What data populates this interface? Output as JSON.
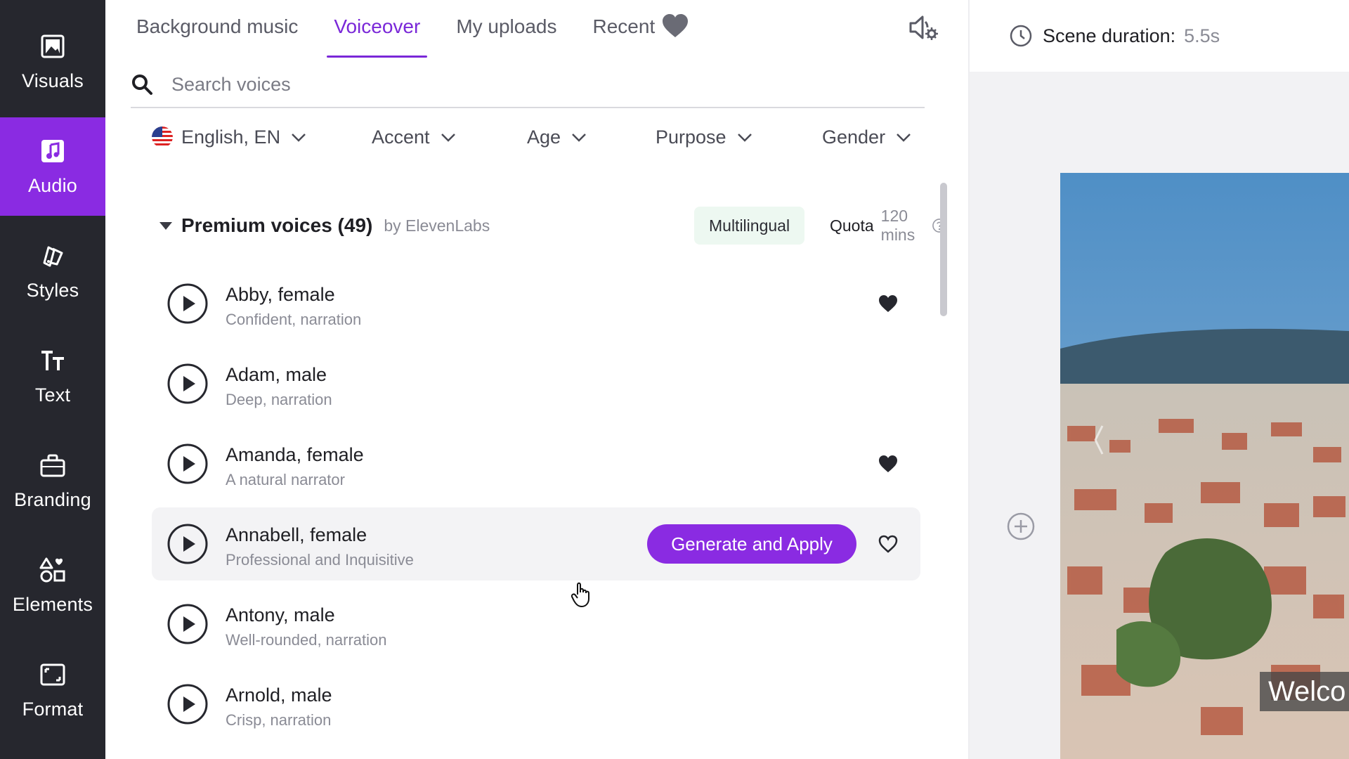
{
  "sidebar": {
    "items": [
      {
        "label": "Visuals",
        "icon": "image-icon",
        "active": false
      },
      {
        "label": "Audio",
        "icon": "music-note-icon",
        "active": true
      },
      {
        "label": "Styles",
        "icon": "styles-icon",
        "active": false
      },
      {
        "label": "Text",
        "icon": "text-icon",
        "active": false
      },
      {
        "label": "Branding",
        "icon": "briefcase-icon",
        "active": false
      },
      {
        "label": "Elements",
        "icon": "shapes-icon",
        "active": false
      },
      {
        "label": "Format",
        "icon": "format-icon",
        "active": false
      }
    ]
  },
  "tabs": [
    {
      "label": "Background music",
      "active": false
    },
    {
      "label": "Voiceover",
      "active": true
    },
    {
      "label": "My uploads",
      "active": false
    },
    {
      "label": "Recent",
      "active": false
    }
  ],
  "search": {
    "placeholder": "Search voices",
    "value": ""
  },
  "filters": {
    "language": "English, EN",
    "accent": "Accent",
    "age": "Age",
    "purpose": "Purpose",
    "gender": "Gender"
  },
  "section": {
    "title": "Premium voices (49)",
    "by": "by ElevenLabs",
    "badge": "Multilingual",
    "quota_label": "Quota",
    "quota_value": "120 mins"
  },
  "voices": [
    {
      "name": "Abby, female",
      "desc": "Confident, narration",
      "favorite": true
    },
    {
      "name": "Adam, male",
      "desc": "Deep, narration",
      "favorite": false
    },
    {
      "name": "Amanda, female",
      "desc": "A natural narrator",
      "favorite": true
    },
    {
      "name": "Annabell, female",
      "desc": "Professional and Inquisitive",
      "favorite": false,
      "hovered": true
    },
    {
      "name": "Antony, male",
      "desc": "Well-rounded, narration",
      "favorite": false
    },
    {
      "name": "Arnold, male",
      "desc": "Crisp, narration",
      "favorite": false
    }
  ],
  "generate_button": "Generate and Apply",
  "scene": {
    "label": "Scene duration:",
    "value": "5.5s"
  },
  "caption": "Welco",
  "colors": {
    "accent": "#8a2be2",
    "sidebar": "#26272e",
    "badge_bg": "#edf8f1"
  }
}
